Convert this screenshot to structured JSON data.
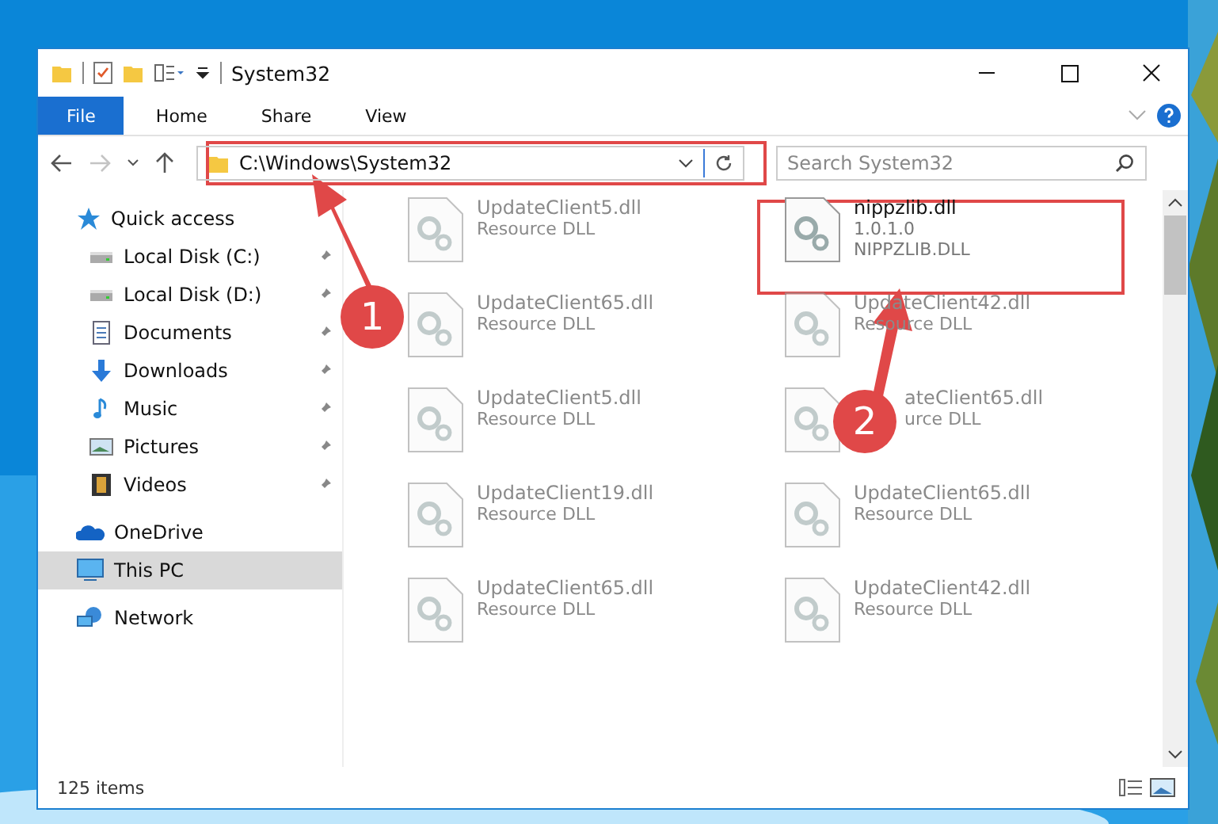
{
  "window": {
    "title": "System32"
  },
  "ribbon_tabs": [
    {
      "label": "File",
      "selected": true
    },
    {
      "label": "Home",
      "selected": false
    },
    {
      "label": "Share",
      "selected": false
    },
    {
      "label": "View",
      "selected": false
    }
  ],
  "address": {
    "path": "C:\\Windows\\System32"
  },
  "search": {
    "placeholder": "Search System32"
  },
  "sidebar": {
    "items": [
      {
        "label": "Quick access",
        "kind": "star",
        "pinned": false,
        "selected": false,
        "children": [
          {
            "label": "Local Disk (C:)",
            "kind": "disk",
            "pinned": true,
            "selected": false
          },
          {
            "label": "Local Disk (D:)",
            "kind": "disk",
            "pinned": true,
            "selected": false
          },
          {
            "label": "Documents",
            "kind": "doc",
            "pinned": true,
            "selected": false
          },
          {
            "label": "Downloads",
            "kind": "down",
            "pinned": true,
            "selected": false
          },
          {
            "label": "Music",
            "kind": "music",
            "pinned": true,
            "selected": false
          },
          {
            "label": "Pictures",
            "kind": "pic",
            "pinned": true,
            "selected": false
          },
          {
            "label": "Videos",
            "kind": "video",
            "pinned": true,
            "selected": false
          }
        ]
      },
      {
        "label": "OneDrive",
        "kind": "cloud",
        "pinned": false,
        "selected": false
      },
      {
        "label": "This PC",
        "kind": "pc",
        "pinned": false,
        "selected": true
      },
      {
        "label": "Network",
        "kind": "net",
        "pinned": false,
        "selected": false
      }
    ]
  },
  "files": [
    {
      "name": "UpdateClient5.dll",
      "detail": "Resource DLL",
      "dimmed": true
    },
    {
      "name": "nippzlib.dll",
      "detail": "1.0.1.0",
      "extra": "NIPPZLIB.DLL",
      "dimmed": false
    },
    {
      "name": "UpdateClient65.dll",
      "detail": "Resource DLL",
      "dimmed": true
    },
    {
      "name": "UpdateClient42.dll",
      "detail": "Resource DLL",
      "dimmed": true
    },
    {
      "name": "UpdateClient5.dll",
      "detail": "Resource DLL",
      "dimmed": true
    },
    {
      "name": "ateClient65.dll",
      "detail": "urce DLL",
      "dimmed": true,
      "covered": true
    },
    {
      "name": "UpdateClient19.dll",
      "detail": "Resource DLL",
      "dimmed": true
    },
    {
      "name": "UpdateClient65.dll",
      "detail": "Resource DLL",
      "dimmed": true
    },
    {
      "name": "UpdateClient65.dll",
      "detail": "Resource DLL",
      "dimmed": true
    },
    {
      "name": "UpdateClient42.dll",
      "detail": "Resource DLL",
      "dimmed": true
    }
  ],
  "status_bar": {
    "count": "125 items"
  },
  "annotations": [
    {
      "label": "1"
    },
    {
      "label": "2"
    }
  ]
}
